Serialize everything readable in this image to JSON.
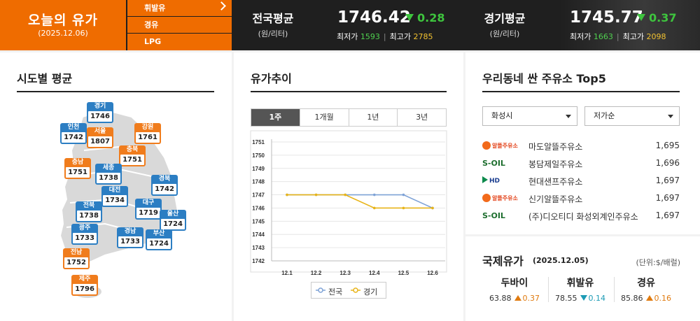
{
  "header": {
    "title": "오늘의 유가",
    "date": "(2025.12.06)",
    "fuel_menu": [
      "휘발유",
      "경유",
      "LPG"
    ],
    "national": {
      "label": "전국평균",
      "unit": "(원/리터)",
      "price": "1746.42",
      "change": "0.28",
      "min_label": "최저가",
      "min": "1593",
      "max_label": "최고가",
      "max": "2785"
    },
    "gyeonggi": {
      "label": "경기평균",
      "unit": "(원/리터)",
      "price": "1745.77",
      "change": "0.37",
      "min_label": "최저가",
      "min": "1663",
      "max_label": "최고가",
      "max": "2098"
    }
  },
  "regions": {
    "title": "시도별 평균",
    "items": [
      {
        "name": "경기",
        "value": "1746",
        "color": "#2c7ec3"
      },
      {
        "name": "인천",
        "value": "1742",
        "color": "#2c7ec3"
      },
      {
        "name": "서울",
        "value": "1807",
        "color": "#f07c1c"
      },
      {
        "name": "강원",
        "value": "1761",
        "color": "#f07c1c"
      },
      {
        "name": "충북",
        "value": "1751",
        "color": "#f07c1c"
      },
      {
        "name": "충남",
        "value": "1751",
        "color": "#f07c1c"
      },
      {
        "name": "세종",
        "value": "1738",
        "color": "#2c7ec3"
      },
      {
        "name": "경북",
        "value": "1742",
        "color": "#2c7ec3"
      },
      {
        "name": "대전",
        "value": "1734",
        "color": "#2c7ec3"
      },
      {
        "name": "전북",
        "value": "1738",
        "color": "#2c7ec3"
      },
      {
        "name": "대구",
        "value": "1719",
        "color": "#2c7ec3"
      },
      {
        "name": "울산",
        "value": "1724",
        "color": "#2c7ec3"
      },
      {
        "name": "광주",
        "value": "1733",
        "color": "#2c7ec3"
      },
      {
        "name": "경남",
        "value": "1733",
        "color": "#2c7ec3"
      },
      {
        "name": "부산",
        "value": "1724",
        "color": "#2c7ec3"
      },
      {
        "name": "전남",
        "value": "1752",
        "color": "#f07c1c"
      },
      {
        "name": "제주",
        "value": "1796",
        "color": "#f07c1c"
      }
    ]
  },
  "trend": {
    "title": "유가추이",
    "tabs": [
      "1주",
      "1개월",
      "1년",
      "3년"
    ],
    "active_tab": 0
  },
  "chart_data": {
    "type": "line",
    "x": [
      "12.1",
      "12.2",
      "12.3",
      "12.4",
      "12.5",
      "12.6"
    ],
    "series": [
      {
        "name": "전국",
        "values": [
          1747,
          1747,
          1747,
          1747,
          1747,
          1746
        ],
        "color": "#7ea2d6"
      },
      {
        "name": "경기",
        "values": [
          1747,
          1747,
          1747,
          1746,
          1746,
          1746
        ],
        "color": "#e8b418"
      }
    ],
    "yticks": [
      1742,
      1743,
      1744,
      1745,
      1746,
      1747,
      1748,
      1749,
      1750,
      1751
    ],
    "ylim": [
      1742,
      1751
    ],
    "grid": true,
    "legend_position": "bottom"
  },
  "top5": {
    "title": "우리동네 싼 주유소 Top5",
    "region_select": "화성시",
    "sort_select": "저가순",
    "stations": [
      {
        "brand": "알뜰주유소",
        "logo": "altteul-logo-icon",
        "name": "마도알뜰주유소",
        "price": "1,695"
      },
      {
        "brand": "S-OIL",
        "logo": "soil-logo-icon",
        "name": "봉담제일주유소",
        "price": "1,696"
      },
      {
        "brand": "HD",
        "logo": "hd-hyundai-oilbank-logo-icon",
        "name": "현대샌프주유소",
        "price": "1,697"
      },
      {
        "brand": "알뜰주유소",
        "logo": "altteul-logo-icon",
        "name": "신기알뜰주유소",
        "price": "1,697"
      },
      {
        "brand": "S-OIL",
        "logo": "soil-logo-icon",
        "name": "(주)디오티디 화성외계인주유소",
        "price": "1,697"
      }
    ]
  },
  "intl": {
    "title": "국제유가",
    "date": "(2025.12.05)",
    "unit": "(단위:$/배럴)",
    "items": [
      {
        "name": "두바이",
        "price": "63.88",
        "change": "0.37",
        "dir": "up"
      },
      {
        "name": "휘발유",
        "price": "78.55",
        "change": "0.14",
        "dir": "down"
      },
      {
        "name": "경유",
        "price": "85.86",
        "change": "0.16",
        "dir": "up"
      }
    ]
  }
}
